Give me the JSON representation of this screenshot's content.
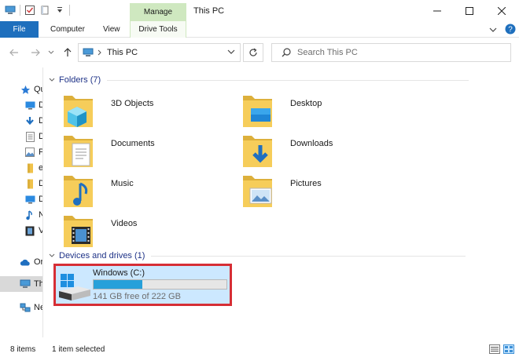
{
  "window": {
    "title": "This PC",
    "context_tab": "Manage",
    "controls": {
      "minimize": "—",
      "maximize": "☐",
      "close": "✕"
    }
  },
  "ribbon": {
    "tabs": [
      {
        "label": "File"
      },
      {
        "label": "Computer"
      },
      {
        "label": "View"
      },
      {
        "label": "Drive Tools"
      }
    ]
  },
  "address": {
    "back_icon": "arrow-left-icon",
    "forward_icon": "arrow-right-icon",
    "breadcrumb": [
      "This PC"
    ],
    "search_placeholder": "Search This PC"
  },
  "nav_pane": {
    "items": [
      {
        "label": "Qu",
        "icon": "star-icon"
      },
      {
        "label": "D",
        "icon": "desktop-icon"
      },
      {
        "label": "D",
        "icon": "downloads-icon"
      },
      {
        "label": "D",
        "icon": "documents-icon"
      },
      {
        "label": "P",
        "icon": "pictures-icon"
      },
      {
        "label": "e",
        "icon": "folder-icon"
      },
      {
        "label": "D",
        "icon": "folder-icon"
      },
      {
        "label": "D",
        "icon": "desktop-icon"
      },
      {
        "label": "N",
        "icon": "music-icon"
      },
      {
        "label": "V",
        "icon": "videos-icon"
      },
      {
        "label": "Or",
        "icon": "onedrive-icon"
      },
      {
        "label": "Th",
        "icon": "this-pc-icon"
      },
      {
        "label": "Ne",
        "icon": "network-icon"
      }
    ]
  },
  "folders_group": {
    "header": "Folders (7)",
    "items": [
      {
        "name": "3D Objects",
        "icon": "3d-objects-folder-icon"
      },
      {
        "name": "Desktop",
        "icon": "desktop-folder-icon"
      },
      {
        "name": "Documents",
        "icon": "documents-folder-icon"
      },
      {
        "name": "Downloads",
        "icon": "downloads-folder-icon"
      },
      {
        "name": "Music",
        "icon": "music-folder-icon"
      },
      {
        "name": "Pictures",
        "icon": "pictures-folder-icon"
      },
      {
        "name": "Videos",
        "icon": "videos-folder-icon"
      }
    ]
  },
  "drives_group": {
    "header": "Devices and drives (1)",
    "drives": [
      {
        "name": "Windows (C:)",
        "free_text": "141 GB free of 222 GB",
        "used_fraction": 0.365
      }
    ]
  },
  "status": {
    "item_count": "8 items",
    "selection": "1 item selected"
  },
  "colors": {
    "accent": "#1e6fbd",
    "manage_tab": "#cfe8c0",
    "selection": "#cce8ff",
    "highlight_border": "#d62e35",
    "usage_bar": "#26a0da"
  }
}
